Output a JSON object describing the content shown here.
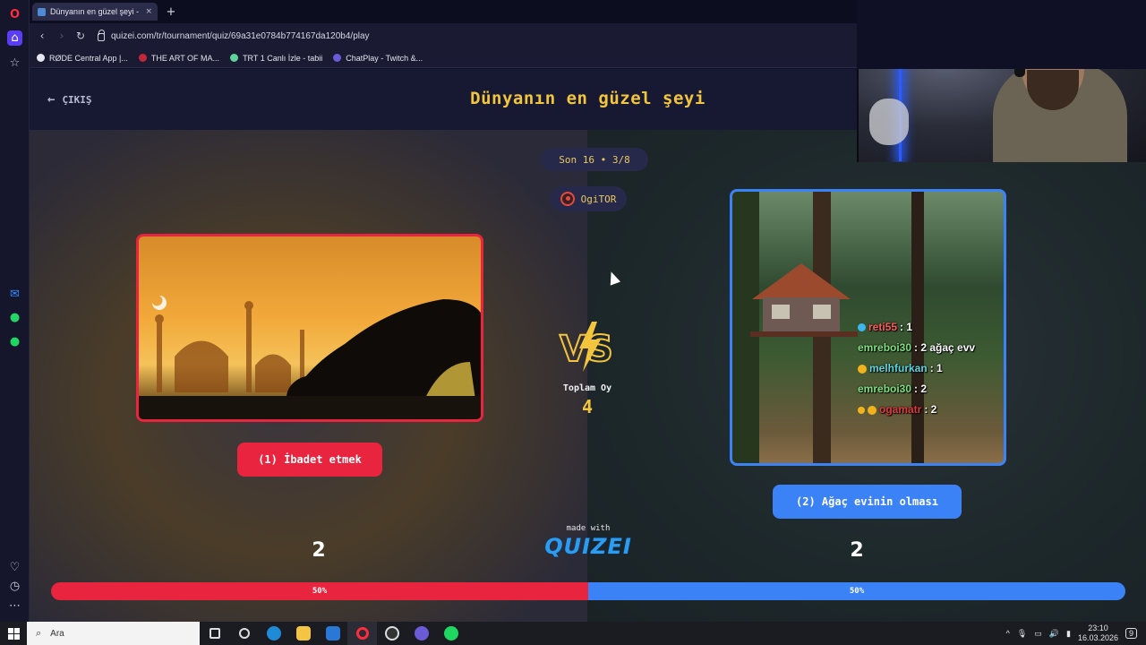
{
  "browser": {
    "tab_title": "Dünyanın en güzel şeyi -",
    "tab_close": "×",
    "new_tab": "+",
    "url": "quizei.com/tr/tournament/quiz/69a31e0784b774167da120b4/play",
    "bookmarks": [
      {
        "label": "RØDE Central App |...",
        "color": "#e6e6ee"
      },
      {
        "label": "THE ART OF MA...",
        "color": "#c0283a"
      },
      {
        "label": "TRT 1 Canlı İzle - tabii",
        "color": "#5ed39a"
      },
      {
        "label": "ChatPlay - Twitch &...",
        "color": "#6d5bd6"
      }
    ]
  },
  "quiz": {
    "exit_label": "ÇIKIŞ",
    "title": "Dünyanın en güzel şeyi",
    "round": "Son 16 • 3/8",
    "user": "OgiTOR",
    "total_label": "Toplam Oy",
    "total_value": "4",
    "made_with": "made with",
    "brand": "QUIZEI",
    "options": [
      {
        "label": "(1) İbadet etmek",
        "votes": "2",
        "percent_label": "50%",
        "percent": 50,
        "color": "#e8243f"
      },
      {
        "label": "(2) Ağaç evinin olması",
        "votes": "2",
        "percent_label": "50%",
        "percent": 50,
        "color": "#3b82f6"
      }
    ]
  },
  "chat": [
    {
      "user": "reti55",
      "message": ": 1",
      "user_color": "#ff5a5a"
    },
    {
      "user": "emreboi30",
      "message": ": 2 ağaç evv",
      "user_color": "#7ee07e"
    },
    {
      "user": "melhfurkan",
      "message": ": 1",
      "user_color": "#5ad6e0"
    },
    {
      "user": "emreboi30",
      "message": ": 2",
      "user_color": "#7ee07e"
    },
    {
      "user": "ogamatr",
      "message": ": 2",
      "user_color": "#e03a3a"
    }
  ],
  "taskbar": {
    "search_placeholder": "Ara",
    "time": "23:10",
    "date": "16.03.2026",
    "notification_count": "9"
  }
}
